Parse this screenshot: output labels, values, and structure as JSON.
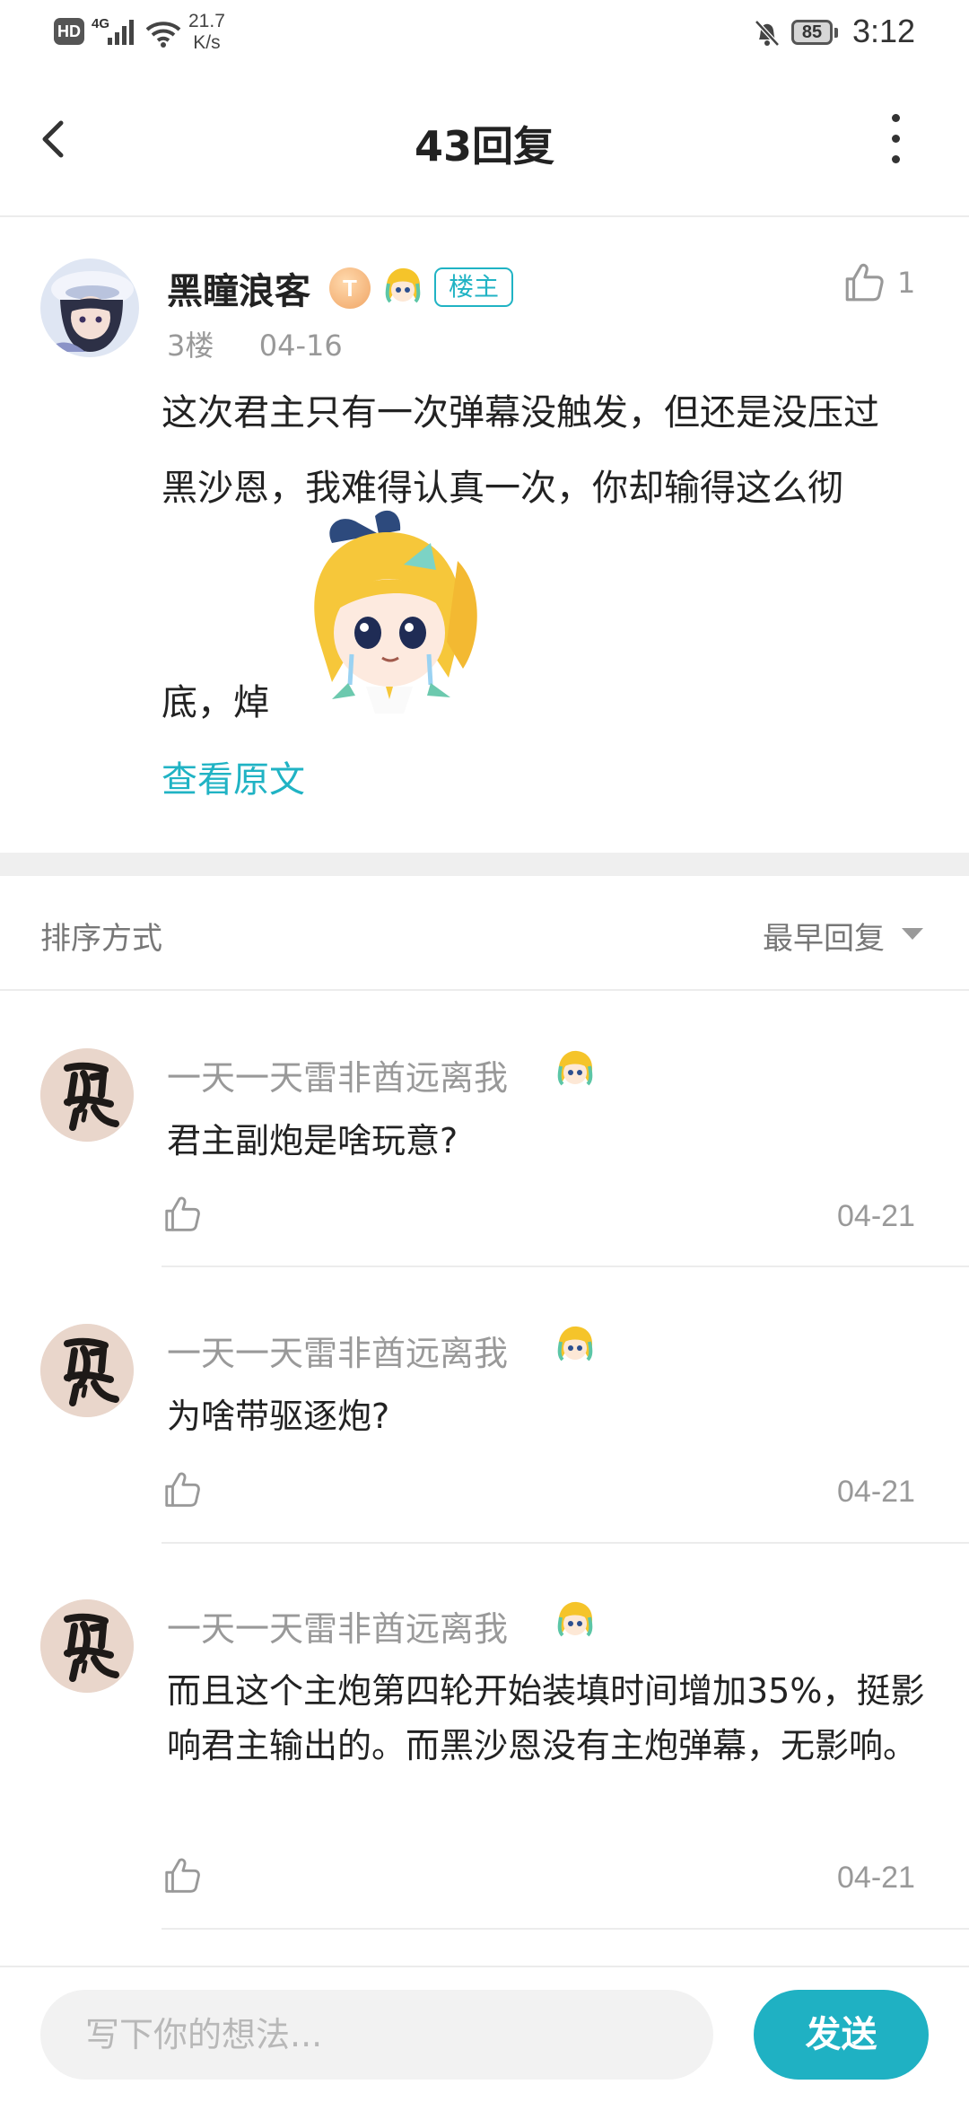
{
  "status_bar": {
    "hd": "HD",
    "network": "4G",
    "speed_value": "21.7",
    "speed_unit": "K/s",
    "battery": "85",
    "time": "3:12"
  },
  "header": {
    "title": "43回复"
  },
  "post": {
    "author": "黑瞳浪客",
    "level_badge": "T",
    "op_tag": "楼主",
    "likes": "1",
    "floor": "3楼",
    "date": "04-16",
    "text_line1": "这次君主只有一次弹幕没触发，但还是没压过",
    "text_line2": "黑沙恩，我难得认真一次，你却输得这么彻",
    "text_line3": "底，焯",
    "view_original": "查看原文"
  },
  "sort": {
    "label": "排序方式",
    "selected": "最早回复"
  },
  "replies": [
    {
      "author": "一天一天雷非酋远离我",
      "text": "君主副炮是啥玩意?",
      "date": "04-21"
    },
    {
      "author": "一天一天雷非酋远离我",
      "text": "为啥带驱逐炮?",
      "date": "04-21"
    },
    {
      "author": "一天一天雷非酋远离我",
      "text": "而且这个主炮第四轮开始装填时间增加35%，挺影响君主输出的。而黑沙恩没有主炮弹幕，无影响。",
      "date": "04-21"
    }
  ],
  "composer": {
    "placeholder": "写下你的想法...",
    "send_label": "发送"
  },
  "colors": {
    "accent": "#20b3c4",
    "send_button": "#1fb1c3",
    "muted_text": "#999999"
  },
  "icons": [
    "hd-icon",
    "signal-icon",
    "wifi-icon",
    "mute-bell-icon",
    "battery-icon",
    "back-arrow-icon",
    "more-vertical-icon",
    "thumbs-up-icon",
    "level-badge-icon",
    "emoji-girl-icon",
    "caret-down-icon"
  ]
}
